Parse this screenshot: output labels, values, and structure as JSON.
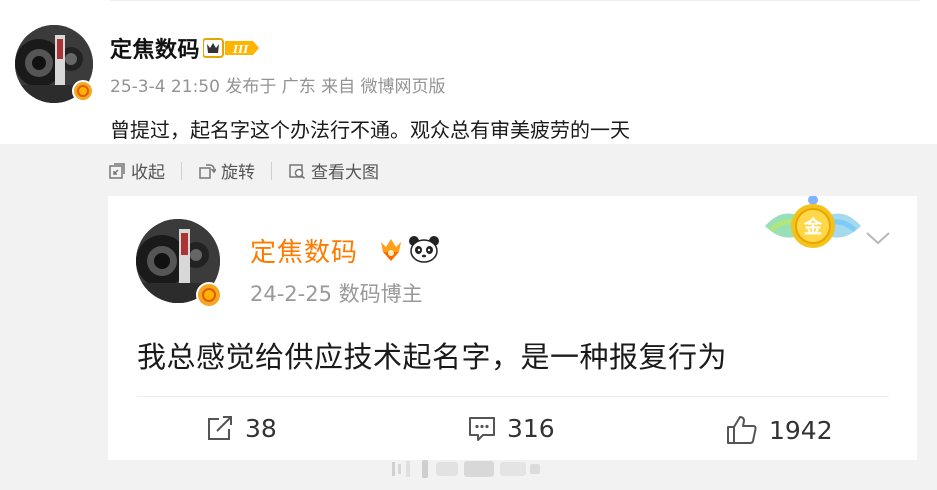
{
  "outer_post": {
    "author": "定焦数码",
    "meta": "25-3-4 21:50 发布于 广东 来自 微博网页版",
    "text": "曾提过，起名字这个办法行不通。观众总有审美疲劳的一天"
  },
  "toolbar": {
    "collapse_label": "收起",
    "rotate_label": "旋转",
    "view_large_label": "查看大图"
  },
  "quoted_card": {
    "author": "定焦数码",
    "meta": "24-2-25  数码博主",
    "text": "我总感觉给供应技术起名字，是一种报复行为",
    "medal_label": "金",
    "actions": {
      "share": "38",
      "comment": "316",
      "like": "1942"
    }
  },
  "colors": {
    "accent_orange": "#ff7b00",
    "verified_gold": "#f5a623",
    "panel_bg": "#f2f2f2"
  }
}
